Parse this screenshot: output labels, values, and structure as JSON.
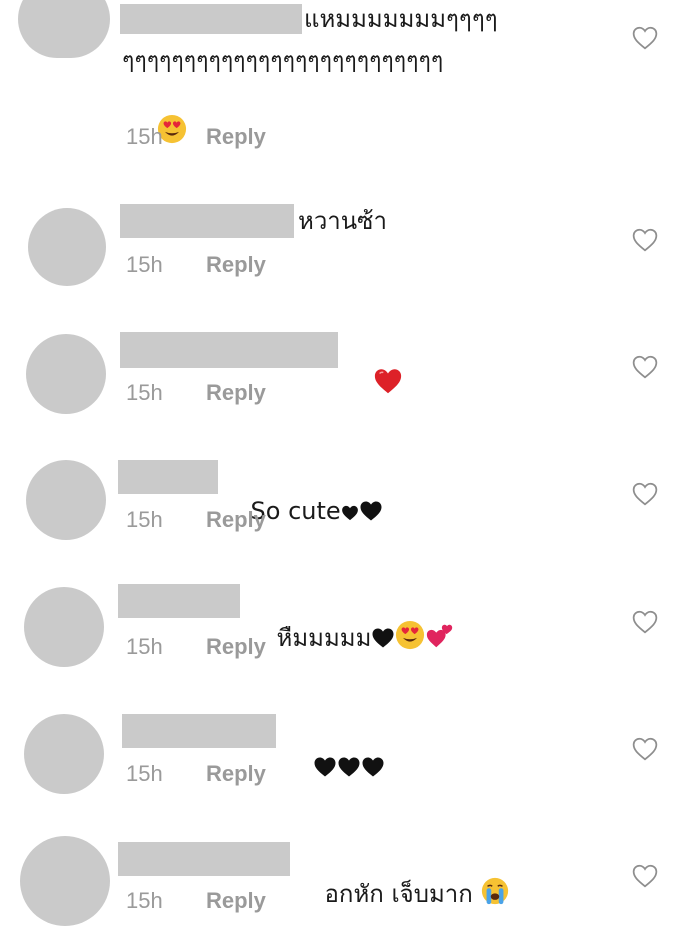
{
  "comments": [
    {
      "line1": "แหมมมมมมมๆๆๆๆ",
      "line2": "ๆๆๆๆๆๆๆๆๆๆๆๆๆๆๆๆๆๆๆๆๆๆๆๆๆๆ",
      "time": "15h",
      "reply": "Reply"
    },
    {
      "text": "หวานซ้า",
      "time": "15h",
      "reply": "Reply"
    },
    {
      "time": "15h",
      "reply": "Reply"
    },
    {
      "text": "So cute",
      "time": "15h",
      "reply": "Reply"
    },
    {
      "text": "หืมมมมม",
      "time": "15h",
      "reply": "Reply"
    },
    {
      "time": "15h",
      "reply": "Reply"
    },
    {
      "text": "อกหัก เจ็บมาก",
      "time": "15h",
      "reply": "Reply"
    }
  ],
  "icons": {
    "like": "heart-outline-icon",
    "heart_eyes": "heart-eyes-emoji",
    "red_heart": "red-heart-emoji",
    "black_heart": "black-heart-emoji",
    "two_hearts": "two-hearts-emoji",
    "crying": "crying-face-emoji"
  },
  "colors": {
    "placeholder": "#cacaca",
    "meta_text": "#9a9a9a",
    "body_text": "#1a1a1a"
  }
}
